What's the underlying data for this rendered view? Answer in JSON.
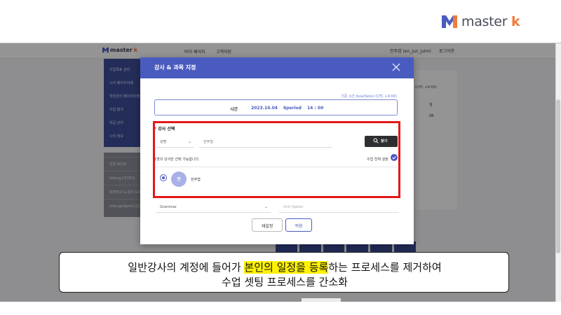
{
  "brand": {
    "name_main": "master",
    "name_accent": "k"
  },
  "app": {
    "logo_main": "master",
    "logo_accent": "k",
    "nav": [
      "마이 페이지",
      "고객지원"
    ],
    "user": "전주엽 (en_jun_juim)",
    "logout": "로그아웃",
    "sidebar_blue": [
      "수업목표 관리",
      "나의 페이지이메",
      "학원관리 페이지이엠",
      "수업 평가",
      "학급 관리",
      "나의 정보"
    ],
    "sidebar_grey": [
      "전일 포인트",
      "idkong [아이디]",
      "대한최고 & 윤이 드리",
      "idkong/idjem/12간"
    ],
    "right_panel": {
      "tz": "(UTC +9:00)",
      "col1": "일",
      "col2": "08"
    }
  },
  "modal": {
    "title": "강사 & 과목 지정",
    "timezone": "기준 시간 Asia/Seoul (UTC +9:00)",
    "time_label": "시간",
    "time_date": "2023.10.04",
    "time_period": "6period",
    "time_clock": "14 : 00",
    "select_label": "강사 선택",
    "required_mark": "*",
    "dropdown_value": "성명",
    "search_value": "전주엽",
    "search_button": "찾기",
    "notice": "1명의 강사만 선택 가능합니다.",
    "multi_select": "수업 전체 설정",
    "teacher_avatar": "전",
    "teacher_name": "전주엽",
    "subject_value": "Grammar",
    "unit_placeholder": "Unit Option",
    "reset_button": "재설정",
    "apply_button": "적용"
  },
  "caption": {
    "line1_pre": "일반강사의 계정에 들어가 ",
    "line1_highlight": "본인의 일정을 등록",
    "line1_post": "하는 프로세스를 제거하여",
    "line2": "수업 셋팅 프로세스를 간소화"
  },
  "colors": {
    "accent_blue": "#4a5bbf",
    "highlight_red": "#e31818",
    "caption_highlight": "#fff200"
  }
}
